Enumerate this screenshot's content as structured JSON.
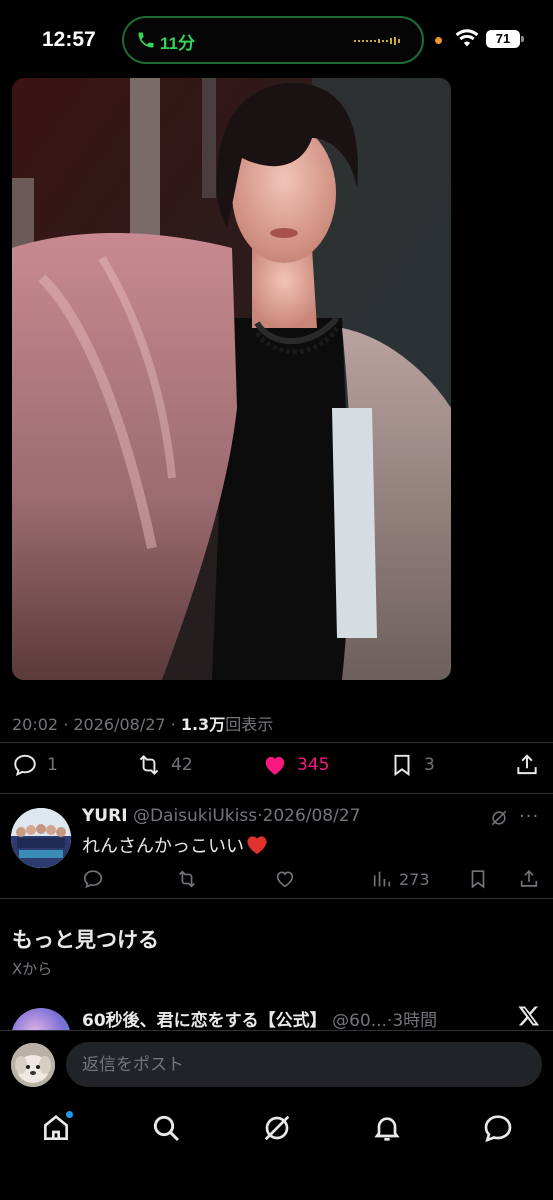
{
  "status_bar": {
    "time": "12:57",
    "call_duration": "11分",
    "battery": "71"
  },
  "post": {
    "photo_icon": "portrait-photo",
    "meta_prefix": "20:02 · 2026/08/27 · ",
    "views_count": "1.3万",
    "views_label": "回表示",
    "stats": {
      "replies": "1",
      "reposts": "42",
      "likes": "345",
      "bookmarks": "3"
    }
  },
  "reply": {
    "name": "YURI",
    "handle": "@DaisukiUkiss",
    "date": "·2026/08/27",
    "text": "れんさんかっこいい",
    "views": "273",
    "more": "···"
  },
  "discover": {
    "title": "もっと見つける",
    "subtitle": "Xから",
    "promo_name": "60秒後、君に恋をする【公式】",
    "promo_handle": "@60...",
    "promo_time": "·3時間"
  },
  "composer": {
    "placeholder": "返信をポスト"
  },
  "colors": {
    "background": "#000000",
    "like_pink": "#f91880",
    "muted": "#71767b",
    "call_green": "#36d35c",
    "accent_blue": "#1d9bf0"
  }
}
